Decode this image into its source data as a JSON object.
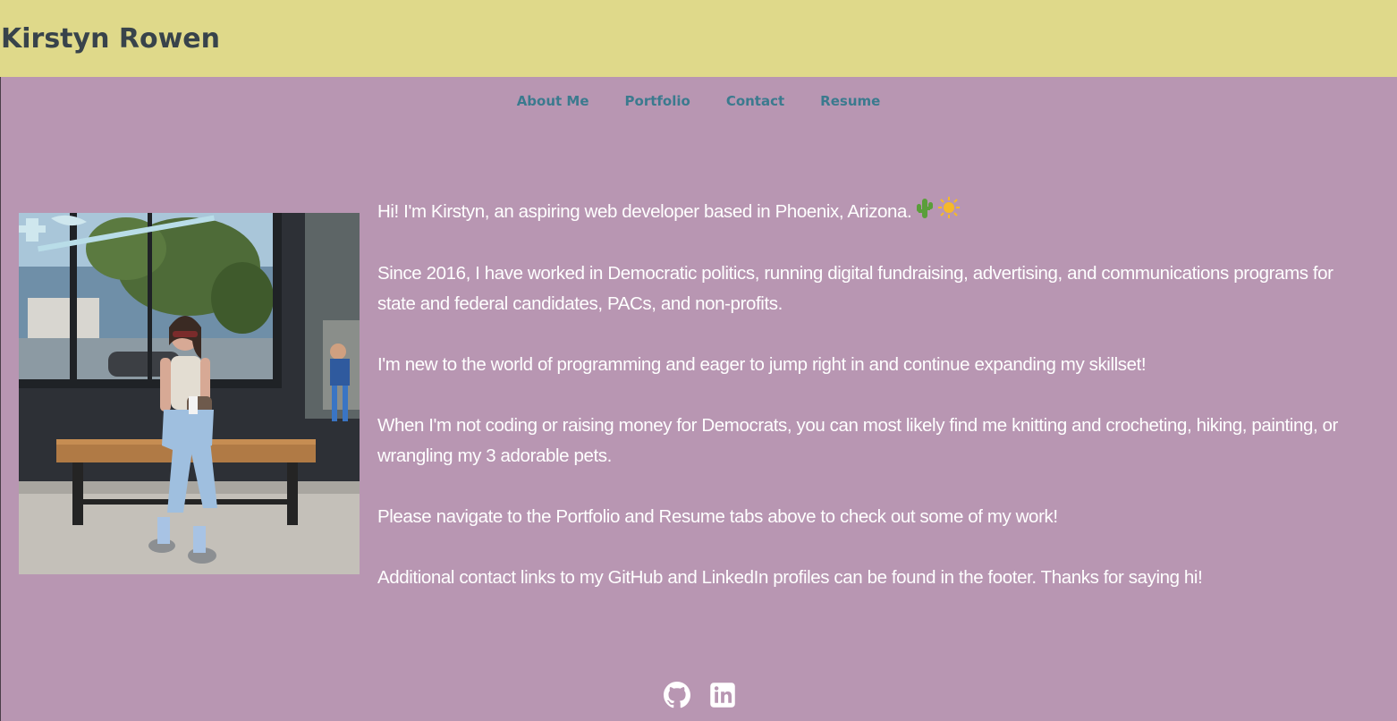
{
  "header": {
    "title": "Kirstyn Rowen",
    "background": "#dfd98a",
    "title_color": "#38434b"
  },
  "nav": {
    "items": [
      {
        "label": "About Me"
      },
      {
        "label": "Portfolio"
      },
      {
        "label": "Contact"
      },
      {
        "label": "Resume"
      }
    ],
    "link_color": "#3b7a8e"
  },
  "page": {
    "background": "#b896b2"
  },
  "profile_photo": {
    "icon": "profile-photo"
  },
  "bio": {
    "paragraphs": [
      "Hi! I'm Kirstyn, an aspiring web developer based in Phoenix, Arizona.",
      "Since 2016, I have worked in Democratic politics, running digital fundraising, advertising, and communications programs for state and federal candidates, PACs, and non-profits.",
      "I'm new to the world of programming and eager to jump right in and continue expanding my skillset!",
      "When I'm not coding or raising money for Democrats, you can most likely find me knitting and crocheting, hiking, painting, or wrangling my 3 adorable pets.",
      "Please navigate to the Portfolio and Resume tabs above to check out some of my work!",
      "Additional contact links to my GitHub and LinkedIn profiles can be found in the footer. Thanks for saying hi!"
    ],
    "emojis": [
      "cactus-icon",
      "sun-icon"
    ],
    "text_color": "#ffffff"
  },
  "footer": {
    "icons": [
      "github-icon",
      "linkedin-icon"
    ]
  }
}
